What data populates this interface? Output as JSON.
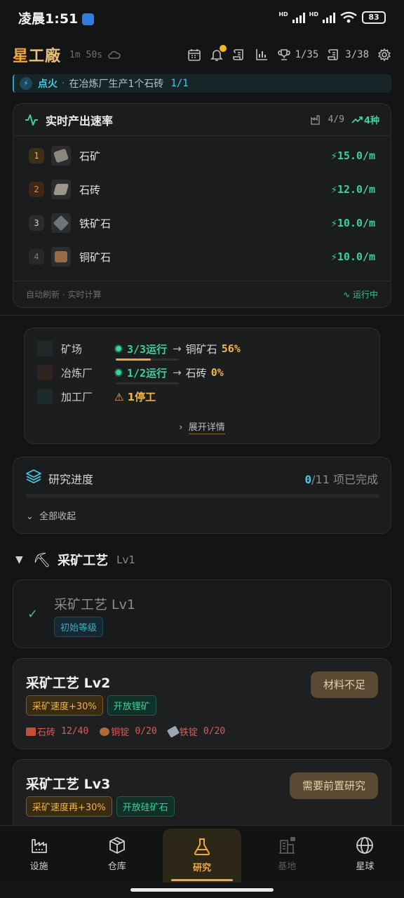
{
  "status": {
    "time": "凌晨1:51",
    "battery": "83",
    "hd": "HD"
  },
  "header": {
    "brand": "星工廠",
    "brand_first": "星",
    "brand_rest": "工廠",
    "timer": "1m 50s",
    "achievements": "1/35",
    "quests": "3/38",
    "icons": [
      "calendar-icon",
      "bell-icon",
      "scroll-icon",
      "bar-chart-icon",
      "trophy-icon",
      "scroll-icon",
      "gear-icon"
    ]
  },
  "task": {
    "name": "点火",
    "sep": "·",
    "desc": "在冶炼厂生产1个石砖",
    "progress": "1/1"
  },
  "production": {
    "title": "实时产出速率",
    "count": "4/9",
    "kinds": "4种",
    "rows": [
      {
        "rank": "1",
        "name": "石矿",
        "rate": "15.0/m",
        "color": "#8a8680"
      },
      {
        "rank": "2",
        "name": "石砖",
        "rate": "12.0/m",
        "color": "#9a958d"
      },
      {
        "rank": "3",
        "name": "铁矿石",
        "rate": "10.0/m",
        "color": "#6f7478"
      },
      {
        "rank": "4",
        "name": "铜矿石",
        "rate": "10.0/m",
        "color": "#9a6a44"
      }
    ],
    "footer_left": "自动刷新 · 实时计算",
    "footer_right": "运行中"
  },
  "facilities": {
    "rows": [
      {
        "name": "矿场",
        "status": "3/3运行",
        "arrow": "→",
        "product": "铜矿石",
        "pct": "56%",
        "progress": 0.56
      },
      {
        "name": "冶炼厂",
        "status": "1/2运行",
        "arrow": "→",
        "product": "石砖",
        "pct": "0%",
        "progress": 0
      },
      {
        "name": "加工厂",
        "warn": "1停工"
      }
    ],
    "expand": "展开详情"
  },
  "research": {
    "title": "研究进度",
    "done_count": "0",
    "done_total": "/11 项已完成",
    "collapse": "全部收起",
    "progress": 0
  },
  "section": {
    "name": "采矿工艺",
    "lv": "Lv1"
  },
  "techs": [
    {
      "title": "采矿工艺 Lv1",
      "tag": "初始等级"
    },
    {
      "title": "采矿工艺 Lv2",
      "tags": [
        "采矿速度+30%",
        "开放锂矿"
      ],
      "button": "材料不足",
      "materials": [
        {
          "name": "石砖",
          "amount": "12/40",
          "color": "#c0503a"
        },
        {
          "name": "铜锭",
          "amount": "0/20",
          "color": "#b06a3a"
        },
        {
          "name": "铁锭",
          "amount": "0/20",
          "color": "#9aa6b0"
        }
      ]
    },
    {
      "title": "采矿工艺 Lv3",
      "tags": [
        "采矿速度再+30%",
        "开放硅矿石"
      ],
      "button": "需要前置研究"
    }
  ],
  "nav": [
    {
      "label": "设施",
      "icon": "factory-icon"
    },
    {
      "label": "仓库",
      "icon": "box-icon"
    },
    {
      "label": "研究",
      "icon": "flask-icon",
      "active": true
    },
    {
      "label": "基地",
      "icon": "building-icon",
      "locked": true
    },
    {
      "label": "星球",
      "icon": "globe-icon"
    }
  ]
}
